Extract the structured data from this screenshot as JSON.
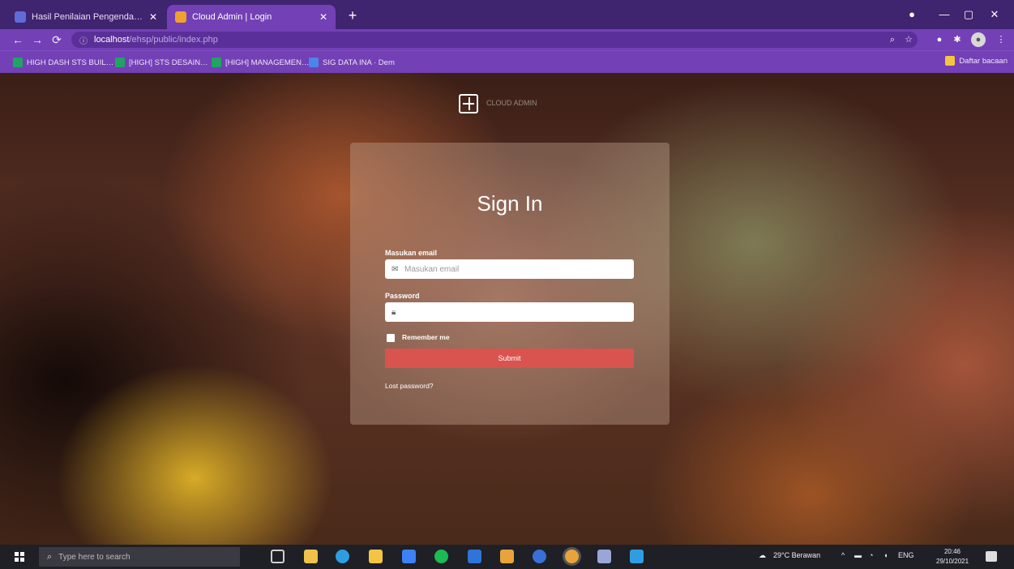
{
  "browser": {
    "tabs": [
      {
        "label": "Hasil Penilaian Pengendalian …",
        "icon": "spreadsheet-favicon",
        "color": "#5f6bd8"
      },
      {
        "label": "Cloud Admin | Login",
        "icon": "cloud-admin-favicon",
        "color": "#f0a030"
      }
    ],
    "new_tab": "+",
    "url_host": "localhost",
    "url_path": "/ehsp/public/index.php",
    "bookmarks": [
      {
        "label": "HIGH DASH STS BUIL…",
        "icon": "bookmark-green-icon",
        "color": "#1fa463"
      },
      {
        "label": "[HIGH] STS DESAIN…",
        "icon": "bookmark-green-icon",
        "color": "#1fa463"
      },
      {
        "label": "[HIGH] MANAGEMEN…",
        "icon": "bookmark-green-icon",
        "color": "#1fa463"
      },
      {
        "label": "SIG DATA INA · Dem",
        "icon": "bookmark-blue-icon",
        "color": "#4a86e8"
      }
    ],
    "reading_list": "Daftar bacaan"
  },
  "page": {
    "logo_text": "CLOUD ADMIN",
    "form": {
      "title": "Sign In",
      "email_label": "Masukan email",
      "email_placeholder": "Masukan email",
      "password_label": "Password",
      "password_placeholder": "",
      "remember_label": "Remember me",
      "submit_label": "Submit",
      "lost_password": "Lost password?"
    }
  },
  "taskbar": {
    "search_placeholder": "Type here to search",
    "weather": "29°C Berawan",
    "language": "ENG",
    "time": "20:46",
    "date": "29/10/2021",
    "apps": [
      {
        "name": "task-view",
        "color": "#cfcfcf"
      },
      {
        "name": "file-explorer",
        "color": "#f0c24a"
      },
      {
        "name": "edge",
        "color": "#2f9ee0"
      },
      {
        "name": "store",
        "color": "#f4c542"
      },
      {
        "name": "mail",
        "color": "#3b82f6"
      },
      {
        "name": "spotify",
        "color": "#1db954"
      },
      {
        "name": "app-blue",
        "color": "#2f74d8"
      },
      {
        "name": "app-orange",
        "color": "#e8a33b"
      },
      {
        "name": "app-red-blue",
        "color": "#3a6fd8"
      },
      {
        "name": "chrome",
        "color": "#e8a33b"
      },
      {
        "name": "app-shield",
        "color": "#9aa6d8"
      },
      {
        "name": "vscode",
        "color": "#2f9ee0"
      }
    ]
  }
}
